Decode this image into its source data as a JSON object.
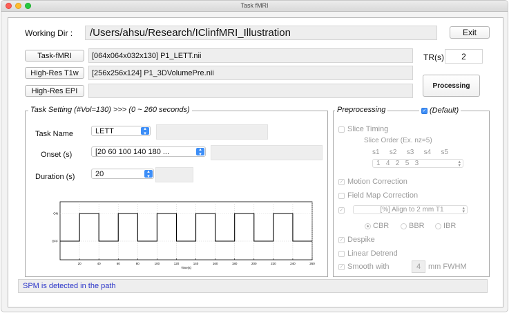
{
  "window": {
    "title": "Task fMRI"
  },
  "working_dir": {
    "label": "Working Dir :",
    "value": "/Users/ahsu/Research/IClinfMRI_Illustration"
  },
  "exit_label": "Exit",
  "files": {
    "task_fmri": {
      "button": "Task-fMRI",
      "value": "[064x064x032x130] P1_LETT.nii"
    },
    "t1w": {
      "button": "High-Res T1w",
      "value": "[256x256x124] P1_3DVolumePre.nii"
    },
    "epi": {
      "button": "High-Res EPI",
      "value": ""
    }
  },
  "tr": {
    "label": "TR(s)",
    "value": "2"
  },
  "processing_label": "Processing",
  "task_setting": {
    "legend": "Task Setting (#Vol=130) >>> (0 ~ 260 seconds)",
    "task_name": {
      "label": "Task Name",
      "value": "LETT"
    },
    "onset": {
      "label": "Onset (s)",
      "value": "[20 60 100 140 180 ..."
    },
    "duration": {
      "label": "Duration (s)",
      "value": "20"
    }
  },
  "chart_data": {
    "type": "line",
    "title": "",
    "xlabel": "Time(s)",
    "ylabel": "",
    "xlim": [
      0,
      260
    ],
    "ylim": [
      0,
      1
    ],
    "x_ticks": [
      20,
      40,
      60,
      80,
      100,
      120,
      140,
      160,
      180,
      200,
      220,
      240,
      260
    ],
    "y_tick_labels": [
      "OFF",
      "ON"
    ],
    "grid": true,
    "series": [
      {
        "x": [
          0,
          20,
          20,
          40,
          40,
          60,
          60,
          80,
          80,
          100,
          100,
          120,
          120,
          140,
          140,
          160,
          160,
          180,
          180,
          200,
          200,
          220,
          220,
          240,
          240,
          260
        ],
        "y": [
          0,
          0,
          1,
          1,
          0,
          0,
          1,
          1,
          0,
          0,
          1,
          1,
          0,
          0,
          1,
          1,
          0,
          0,
          1,
          1,
          0,
          0,
          1,
          1,
          0,
          0
        ]
      }
    ],
    "colors": {
      "line": "#000000",
      "grid": "#cfcfcf"
    }
  },
  "preprocessing": {
    "legend": "Preprocessing",
    "default_label": "(Default)",
    "slice_timing": "Slice Timing",
    "slice_order_label": "Slice Order (Ex. nz=5)",
    "slice_headers": [
      "s1",
      "s2",
      "s3",
      "s4",
      "s5"
    ],
    "slice_values": "1   4   2   5   3",
    "motion_correction": "Motion Correction",
    "field_map": "Field Map Correction",
    "align_value": "[%] Align to 2 mm T1",
    "radios": [
      "CBR",
      "BBR",
      "IBR"
    ],
    "despike": "Despike",
    "linear_detrend": "Linear Detrend",
    "smooth_label": "Smooth with",
    "smooth_value": "4",
    "fwhm_label": "mm FWHM"
  },
  "status": "SPM is detected in the path",
  "icons": {
    "check": "✓",
    "arrows": "updown-arrow-icon"
  }
}
